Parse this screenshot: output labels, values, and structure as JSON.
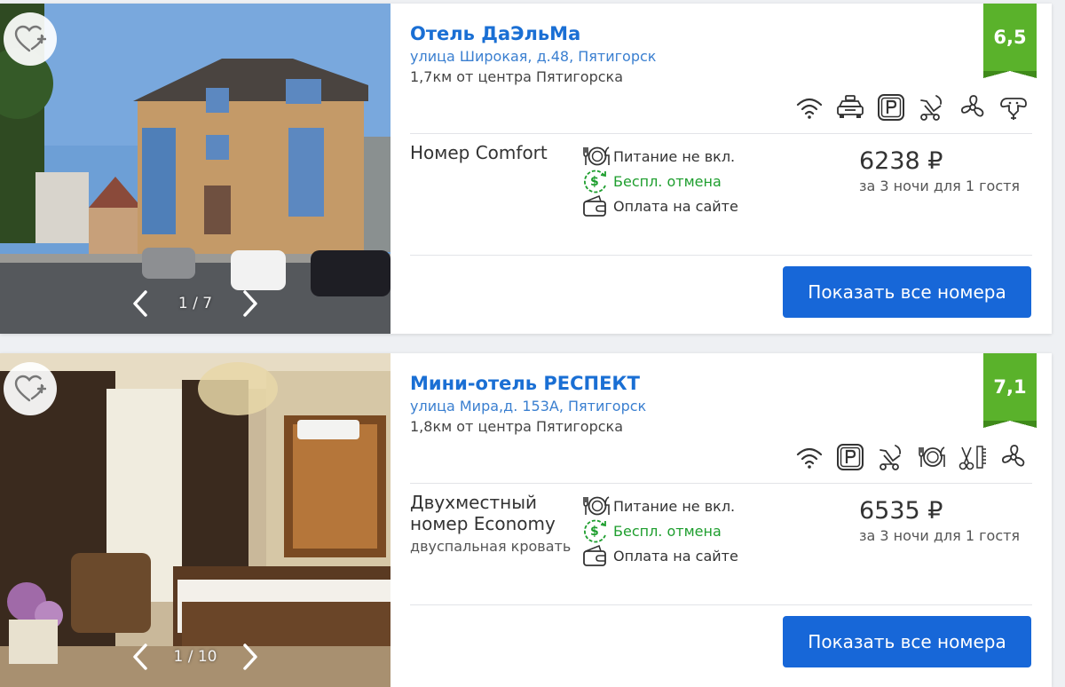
{
  "colors": {
    "accent": "#1767d8",
    "link": "#1a6fd4",
    "rating_bg": "#5ab22b",
    "green_text": "#1e9e2e"
  },
  "hotels": [
    {
      "name": "Отель ДаЭльМа",
      "address": "улица Широкая, д.48, Пятигорск",
      "distance": "1,7км от центра Пятигорска",
      "rating": "6,5",
      "gallery_counter": "1 / 7",
      "amenities": [
        "wifi-icon",
        "taxi-icon",
        "parking-icon",
        "stroller-icon",
        "fan-icon",
        "pets-icon"
      ],
      "room_name": "Номер Comfort",
      "room_sub": "",
      "conditions": {
        "meal": "Питание не вкл.",
        "cancel": "Беспл. отмена",
        "payment": "Оплата на сайте"
      },
      "price": "6238 ₽",
      "price_note": "за 3 ночи для 1 гостя",
      "button": "Показать все номера"
    },
    {
      "name": "Мини-отель РЕСПЕКТ",
      "address": "улица Мира,д. 153А, Пятигорск",
      "distance": "1,8км от центра Пятигорска",
      "rating": "7,1",
      "gallery_counter": "1 / 10",
      "amenities": [
        "wifi-icon",
        "parking-icon",
        "stroller-icon",
        "restaurant-icon",
        "hairdresser-icon",
        "fan-icon"
      ],
      "room_name": "Двухместный номер Economy",
      "room_sub": "двуспальная кровать",
      "conditions": {
        "meal": "Питание не вкл.",
        "cancel": "Беспл. отмена",
        "payment": "Оплата на сайте"
      },
      "price": "6535 ₽",
      "price_note": "за 3 ночи для 1 гостя",
      "button": "Показать все номера"
    }
  ]
}
